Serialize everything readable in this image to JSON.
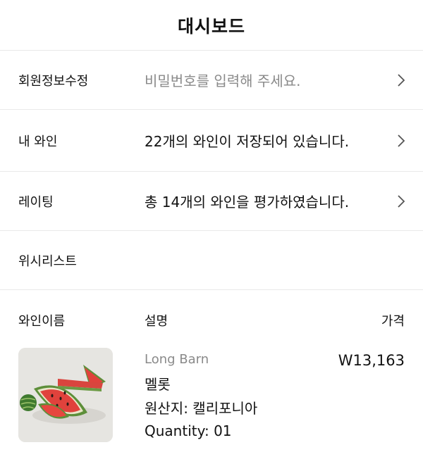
{
  "header": {
    "title": "대시보드"
  },
  "rows": [
    {
      "label": "회원정보수정",
      "value": "비밀번호를 입력해 주세요.",
      "icon": "chevron-right-icon"
    },
    {
      "label": "내 와인",
      "value": "22개의 와인이 저장되어 있습니다.",
      "icon": "chevron-right-icon"
    },
    {
      "label": "레이팅",
      "value": "총 14개의 와인을 평가하였습니다.",
      "icon": "chevron-right-icon"
    },
    {
      "label": "위시리스트"
    }
  ],
  "wishlist_table": {
    "columns": [
      "와인이름",
      "설명",
      "가격"
    ],
    "items": [
      {
        "image": "watermelon-wine-thumbnail",
        "brand": "Long Barn",
        "name": "멜롯",
        "origin": "원산지: 캘리포니아",
        "quantity": "Quantity: 01",
        "price": "W13,163"
      }
    ]
  },
  "colors": {
    "text": "#111111",
    "muted": "#8a8a8a",
    "divider": "#e9e9e9",
    "background": "#ffffff"
  }
}
